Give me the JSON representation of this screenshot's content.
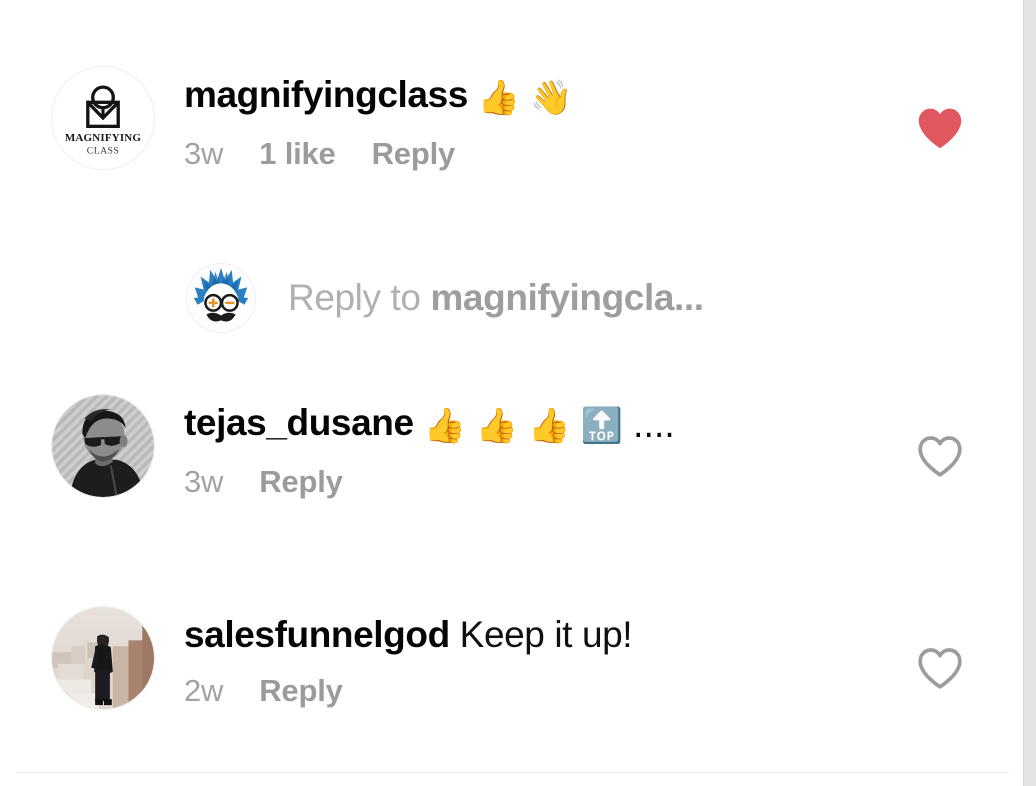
{
  "app": {
    "name": "instagram-comments",
    "background": "#ffffff"
  },
  "colors": {
    "username": "#050505",
    "comment_text": "#101010",
    "meta_grey": "#9a9a9a",
    "placeholder_grey": "#b0b0b0",
    "heart_liked": "#e0575f",
    "heart_outline": "#9c9c9c",
    "divider": "#ebebeb",
    "scrollbar_track": "#e4e4e4"
  },
  "comments": [
    {
      "id": "comment-magnifyingclass",
      "username": "magnifyingclass",
      "text": "",
      "emojis": "👍 👋",
      "emoji_names": [
        "thumbs-up-emoji",
        "waving-hand-emoji"
      ],
      "time": "3w",
      "likes_label": "1 like",
      "reply_label": "Reply",
      "liked": true,
      "like_icon": "heart-filled-icon",
      "avatar_name": "avatar-magnifyingclass",
      "avatar_type": "logo-magnifying-class",
      "avatar_logo_line1": "MAGNIFYING",
      "avatar_logo_line2": "CLASS"
    },
    {
      "id": "comment-tejas-dusane",
      "username": "tejas_dusane",
      "text": "",
      "emojis": "👍 👍 👍 🔝 ....",
      "emoji_names": [
        "thumbs-up-emoji",
        "thumbs-up-emoji",
        "thumbs-up-emoji",
        "top-arrow-emoji",
        "ellipsis-dots"
      ],
      "time": "3w",
      "likes_label": "",
      "reply_label": "Reply",
      "liked": false,
      "like_icon": "heart-outline-icon",
      "avatar_name": "avatar-tejas-dusane",
      "avatar_type": "photo-bw-man-sunglasses"
    },
    {
      "id": "comment-salesfunnelgod",
      "username": "salesfunnelgod",
      "text": "Keep it up!",
      "emojis": "",
      "emoji_names": [],
      "time": "2w",
      "likes_label": "",
      "reply_label": "Reply",
      "liked": false,
      "like_icon": "heart-outline-icon",
      "avatar_name": "avatar-salesfunnelgod",
      "avatar_type": "photo-person-outdoors"
    }
  ],
  "reply_composer": {
    "prefix": "Reply to",
    "target": "magnifyingcla...",
    "placeholder": "Reply to magnifyingcla...",
    "avatar_name": "avatar-current-user",
    "avatar_type": "cartoon-einstein-blue-hair"
  }
}
